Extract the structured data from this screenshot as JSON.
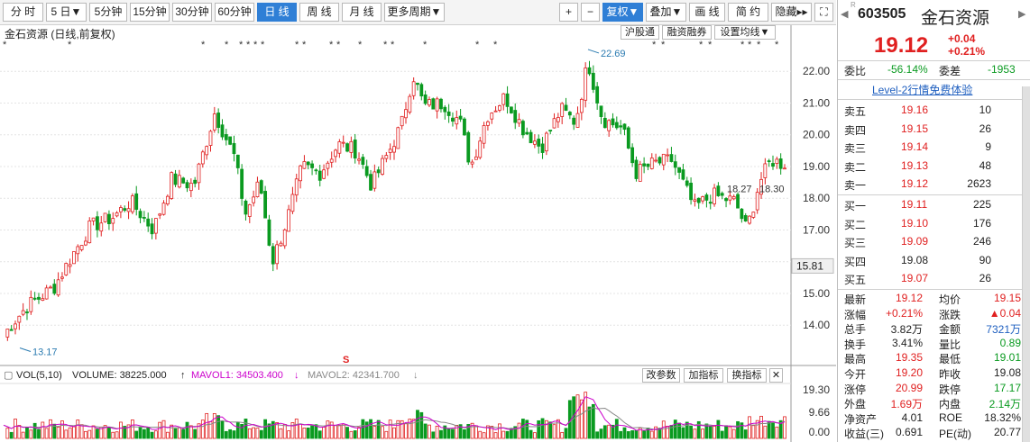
{
  "toolbar": {
    "buttons": [
      {
        "label": "分 时",
        "left": 0
      },
      {
        "label": "5 日▼",
        "left": 0
      },
      {
        "label": "5分钟",
        "left": 0
      },
      {
        "label": "15分钟",
        "left": 0
      },
      {
        "label": "30分钟",
        "left": 0
      },
      {
        "label": "60分钟",
        "left": 0
      },
      {
        "label": "日 线",
        "left": 0
      },
      {
        "label": "周 线",
        "left": 0
      },
      {
        "label": "月 线",
        "left": 0
      },
      {
        "label": "更多周期▼",
        "left": 0
      }
    ],
    "right_buttons": [
      {
        "label": "+"
      },
      {
        "label": "−"
      },
      {
        "label": "复权▼"
      },
      {
        "label": "叠加▼"
      },
      {
        "label": "画 线"
      },
      {
        "label": "简 约"
      },
      {
        "label": "隐藏▸▸"
      },
      {
        "label": "⛶"
      }
    ]
  },
  "chart": {
    "title": "金石资源 (日线,前复权)",
    "tools": [
      "沪股通",
      "融资融券",
      "设置均线▼"
    ],
    "price_ticks": [
      "22.00",
      "21.00",
      "20.00",
      "19.00",
      "18.00",
      "17.00",
      "15.00",
      "14.00"
    ],
    "current_marker": "15.81",
    "high_label": "22.69",
    "low_label": "13.17",
    "ma_label_1": "18.27",
    "ma_label_2": "18.30",
    "event_marker": "S",
    "vol_ticks": [
      "19.30",
      "9.66",
      "0.00"
    ]
  },
  "volume": {
    "label": "VOL(5,10)",
    "volume_text": "VOLUME: 38225.000",
    "mavol1_text": "MAVOL1: 34503.400",
    "mavol2_text": "MAVOL2: 42341.700",
    "tools": [
      "改参数",
      "加指标",
      "换指标",
      "✕"
    ],
    "colors": {
      "mavol1": "#cc00cc",
      "mavol2": "#888888"
    }
  },
  "chart_data": {
    "type": "candlestick",
    "title": "金石资源 (日线,前复权)",
    "price_range": [
      13.17,
      22.69
    ],
    "highest": 22.69,
    "lowest": 13.17,
    "volume_range": [
      0,
      19.3
    ]
  },
  "quote": {
    "code": "603505",
    "name": "金石资源",
    "price": "19.12",
    "change": "+0.04",
    "change_pct": "+0.21%",
    "weibi_label": "委比",
    "weibi": "-56.14%",
    "weicha_label": "委差",
    "weicha": "-1953",
    "level2": "Level-2行情免费体验",
    "asks": [
      {
        "label": "卖五",
        "price": "19.16",
        "vol": "10"
      },
      {
        "label": "卖四",
        "price": "19.15",
        "vol": "26"
      },
      {
        "label": "卖三",
        "price": "19.14",
        "vol": "9"
      },
      {
        "label": "卖二",
        "price": "19.13",
        "vol": "48"
      },
      {
        "label": "卖一",
        "price": "19.12",
        "vol": "2623"
      }
    ],
    "bids": [
      {
        "label": "买一",
        "price": "19.11",
        "vol": "225"
      },
      {
        "label": "买二",
        "price": "19.10",
        "vol": "176"
      },
      {
        "label": "买三",
        "price": "19.09",
        "vol": "246"
      },
      {
        "label": "买四",
        "price": "19.08",
        "vol": "90"
      },
      {
        "label": "买五",
        "price": "19.07",
        "vol": "26"
      }
    ],
    "stats": [
      {
        "l1": "最新",
        "v1": "19.12",
        "c1": "red",
        "l2": "均价",
        "v2": "19.15",
        "c2": "red"
      },
      {
        "l1": "涨幅",
        "v1": "+0.21%",
        "c1": "red",
        "l2": "涨跌",
        "v2": "▲0.04",
        "c2": "red"
      },
      {
        "l1": "总手",
        "v1": "3.82万",
        "c1": "",
        "l2": "金额",
        "v2": "7321万",
        "c2": "blue"
      },
      {
        "l1": "换手",
        "v1": "3.41%",
        "c1": "",
        "l2": "量比",
        "v2": "0.89",
        "c2": "green"
      },
      {
        "l1": "最高",
        "v1": "19.35",
        "c1": "red",
        "l2": "最低",
        "v2": "19.01",
        "c2": "green"
      },
      {
        "l1": "今开",
        "v1": "19.20",
        "c1": "red",
        "l2": "昨收",
        "v2": "19.08",
        "c2": ""
      },
      {
        "l1": "涨停",
        "v1": "20.99",
        "c1": "red",
        "l2": "跌停",
        "v2": "17.17",
        "c2": "green"
      },
      {
        "l1": "外盘",
        "v1": "1.69万",
        "c1": "red",
        "l2": "内盘",
        "v2": "2.14万",
        "c2": "green"
      },
      {
        "l1": "净资产",
        "v1": "4.01",
        "c1": "",
        "l2": "ROE",
        "v2": "18.32%",
        "c2": ""
      },
      {
        "l1": "收益(三)",
        "v1": "0.691",
        "c1": "",
        "l2": "PE(动)",
        "v2": "20.77",
        "c2": ""
      }
    ]
  }
}
